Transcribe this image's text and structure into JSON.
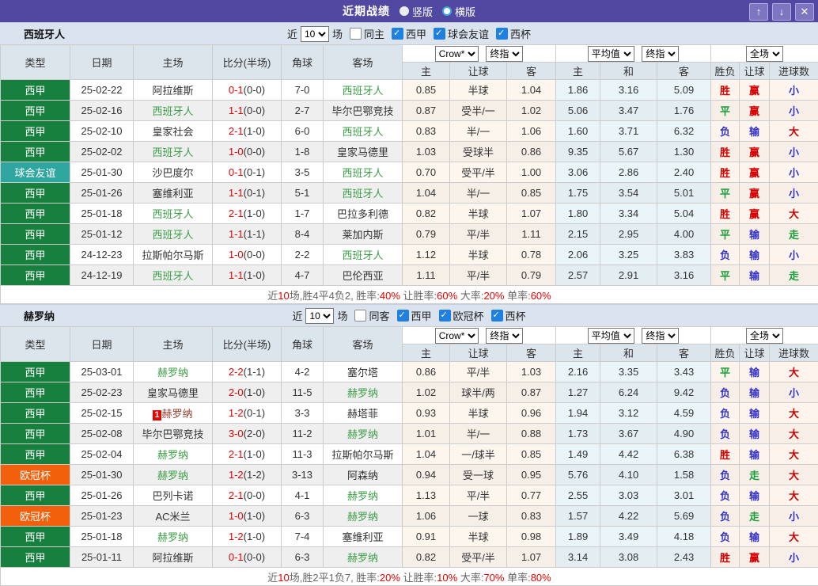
{
  "titlebar": {
    "title": "近期战绩",
    "radios": [
      {
        "label": "竖版",
        "selected": true
      },
      {
        "label": "横版",
        "selected": false
      }
    ],
    "buttons": [
      {
        "name": "move-up",
        "glyph": "↑"
      },
      {
        "name": "move-down",
        "glyph": "↓"
      },
      {
        "name": "close",
        "glyph": "✕"
      }
    ]
  },
  "table_header": {
    "base": [
      "类型",
      "日期",
      "主场",
      "比分(半场)",
      "角球",
      "客场"
    ],
    "sub": [
      "主",
      "让球",
      "客",
      "主",
      "和",
      "客",
      "胜负",
      "让球",
      "进球数"
    ]
  },
  "colors": {
    "titlebar": "#5149A1",
    "laliga_tag": "#18803E",
    "friendly_tag": "#2FA6A0",
    "ucl_tag": "#F2600C",
    "focus_team": "#3DA048",
    "win_red": "#D40000",
    "draw_green": "#1A9E3C",
    "loss_blue": "#3333CC"
  },
  "sections": [
    {
      "team": "西班牙人",
      "filter": {
        "near": "近",
        "count": "10",
        "unit": "场",
        "same": {
          "label": "同主",
          "checked": false
        },
        "leagues": [
          {
            "label": "西甲",
            "checked": true
          },
          {
            "label": "球会友谊",
            "checked": true
          },
          {
            "label": "西杯",
            "checked": true
          }
        ]
      },
      "dropdowns": [
        "Crow*",
        "终指",
        "平均值",
        "终指",
        "全场"
      ],
      "rows": [
        {
          "t": "西甲",
          "tc": "liga",
          "d": "25-02-22",
          "h": "阿拉维斯",
          "hc": "",
          "hb": "",
          "s": "0-1",
          "hf": "(0-0)",
          "c": "7-0",
          "a": "西班牙人",
          "ac": "tg",
          "o1": "0.85",
          "o2": "半球",
          "o3": "1.04",
          "e1": "1.86",
          "e2": "3.16",
          "e3": "5.09",
          "r1": "胜",
          "r2": "赢",
          "r3": "小"
        },
        {
          "t": "西甲",
          "tc": "liga",
          "d": "25-02-16",
          "h": "西班牙人",
          "hc": "tg",
          "hb": "",
          "s": "1-1",
          "hf": "(0-0)",
          "c": "2-7",
          "a": "毕尔巴鄂竞技",
          "ac": "",
          "o1": "0.87",
          "o2": "受半/一",
          "o3": "1.02",
          "e1": "5.06",
          "e2": "3.47",
          "e3": "1.76",
          "r1": "平",
          "r2": "赢",
          "r3": "小"
        },
        {
          "t": "西甲",
          "tc": "liga",
          "d": "25-02-10",
          "h": "皇家社会",
          "hc": "",
          "hb": "",
          "s": "2-1",
          "hf": "(1-0)",
          "c": "6-0",
          "a": "西班牙人",
          "ac": "tg",
          "o1": "0.83",
          "o2": "半/一",
          "o3": "1.06",
          "e1": "1.60",
          "e2": "3.71",
          "e3": "6.32",
          "r1": "负",
          "r2": "输",
          "r3": "大"
        },
        {
          "t": "西甲",
          "tc": "liga",
          "d": "25-02-02",
          "h": "西班牙人",
          "hc": "tg",
          "hb": "",
          "s": "1-0",
          "hf": "(0-0)",
          "c": "1-8",
          "a": "皇家马德里",
          "ac": "",
          "o1": "1.03",
          "o2": "受球半",
          "o3": "0.86",
          "e1": "9.35",
          "e2": "5.67",
          "e3": "1.30",
          "r1": "胜",
          "r2": "赢",
          "r3": "小"
        },
        {
          "t": "球会友谊",
          "tc": "fri",
          "d": "25-01-30",
          "h": "沙巴度尔",
          "hc": "",
          "hb": "",
          "s": "0-1",
          "hf": "(0-1)",
          "c": "3-5",
          "a": "西班牙人",
          "ac": "tg",
          "o1": "0.70",
          "o2": "受平/半",
          "o3": "1.00",
          "e1": "3.06",
          "e2": "2.86",
          "e3": "2.40",
          "r1": "胜",
          "r2": "赢",
          "r3": "小"
        },
        {
          "t": "西甲",
          "tc": "liga",
          "d": "25-01-26",
          "h": "塞维利亚",
          "hc": "",
          "hb": "",
          "s": "1-1",
          "hf": "(0-1)",
          "c": "5-1",
          "a": "西班牙人",
          "ac": "tg",
          "o1": "1.04",
          "o2": "半/一",
          "o3": "0.85",
          "e1": "1.75",
          "e2": "3.54",
          "e3": "5.01",
          "r1": "平",
          "r2": "赢",
          "r3": "小"
        },
        {
          "t": "西甲",
          "tc": "liga",
          "d": "25-01-18",
          "h": "西班牙人",
          "hc": "tg",
          "hb": "",
          "s": "2-1",
          "hf": "(1-0)",
          "c": "1-7",
          "a": "巴拉多利德",
          "ac": "",
          "o1": "0.82",
          "o2": "半球",
          "o3": "1.07",
          "e1": "1.80",
          "e2": "3.34",
          "e3": "5.04",
          "r1": "胜",
          "r2": "赢",
          "r3": "大"
        },
        {
          "t": "西甲",
          "tc": "liga",
          "d": "25-01-12",
          "h": "西班牙人",
          "hc": "tg",
          "hb": "",
          "s": "1-1",
          "hf": "(1-1)",
          "c": "8-4",
          "a": "莱加内斯",
          "ac": "",
          "o1": "0.79",
          "o2": "平/半",
          "o3": "1.11",
          "e1": "2.15",
          "e2": "2.95",
          "e3": "4.00",
          "r1": "平",
          "r2": "输",
          "r3": "走"
        },
        {
          "t": "西甲",
          "tc": "liga",
          "d": "24-12-23",
          "h": "拉斯帕尔马斯",
          "hc": "",
          "hb": "",
          "s": "1-0",
          "hf": "(0-0)",
          "c": "2-2",
          "a": "西班牙人",
          "ac": "tg",
          "o1": "1.12",
          "o2": "半球",
          "o3": "0.78",
          "e1": "2.06",
          "e2": "3.25",
          "e3": "3.83",
          "r1": "负",
          "r2": "输",
          "r3": "小"
        },
        {
          "t": "西甲",
          "tc": "liga",
          "d": "24-12-19",
          "h": "西班牙人",
          "hc": "tg",
          "hb": "",
          "s": "1-1",
          "hf": "(1-0)",
          "c": "4-7",
          "a": "巴伦西亚",
          "ac": "",
          "o1": "1.11",
          "o2": "平/半",
          "o3": "0.79",
          "e1": "2.57",
          "e2": "2.91",
          "e3": "3.16",
          "r1": "平",
          "r2": "输",
          "r3": "走"
        }
      ],
      "summary": [
        [
          "近",
          false
        ],
        [
          "10",
          true
        ],
        [
          "场,胜4平4负2, 胜率:",
          false
        ],
        [
          "40%",
          true
        ],
        [
          " 让胜率:",
          false
        ],
        [
          "60%",
          true
        ],
        [
          " 大率:",
          false
        ],
        [
          "20%",
          true
        ],
        [
          " 单率:",
          false
        ],
        [
          "60%",
          true
        ]
      ]
    },
    {
      "team": "赫罗纳",
      "filter": {
        "near": "近",
        "count": "10",
        "unit": "场",
        "same": {
          "label": "同客",
          "checked": false
        },
        "leagues": [
          {
            "label": "西甲",
            "checked": true
          },
          {
            "label": "欧冠杯",
            "checked": true
          },
          {
            "label": "西杯",
            "checked": true
          }
        ]
      },
      "dropdowns": [
        "Crow*",
        "终指",
        "平均值",
        "终指",
        "全场"
      ],
      "rows": [
        {
          "t": "西甲",
          "tc": "liga",
          "d": "25-03-01",
          "h": "赫罗纳",
          "hc": "tg",
          "hb": "",
          "s": "2-2",
          "hf": "(1-1)",
          "c": "4-2",
          "a": "塞尔塔",
          "ac": "",
          "o1": "0.86",
          "o2": "平/半",
          "o3": "1.03",
          "e1": "2.16",
          "e2": "3.35",
          "e3": "3.43",
          "r1": "平",
          "r2": "输",
          "r3": "大"
        },
        {
          "t": "西甲",
          "tc": "liga",
          "d": "25-02-23",
          "h": "皇家马德里",
          "hc": "",
          "hb": "",
          "s": "2-0",
          "hf": "(1-0)",
          "c": "11-5",
          "a": "赫罗纳",
          "ac": "tg",
          "o1": "1.02",
          "o2": "球半/两",
          "o3": "0.87",
          "e1": "1.27",
          "e2": "6.24",
          "e3": "9.42",
          "r1": "负",
          "r2": "输",
          "r3": "小"
        },
        {
          "t": "西甲",
          "tc": "liga",
          "d": "25-02-15",
          "h": "赫罗纳",
          "hc": "tm",
          "hb": "1",
          "s": "1-2",
          "hf": "(0-1)",
          "c": "3-3",
          "a": "赫塔菲",
          "ac": "",
          "o1": "0.93",
          "o2": "半球",
          "o3": "0.96",
          "e1": "1.94",
          "e2": "3.12",
          "e3": "4.59",
          "r1": "负",
          "r2": "输",
          "r3": "大"
        },
        {
          "t": "西甲",
          "tc": "liga",
          "d": "25-02-08",
          "h": "毕尔巴鄂竞技",
          "hc": "",
          "hb": "",
          "s": "3-0",
          "hf": "(2-0)",
          "c": "11-2",
          "a": "赫罗纳",
          "ac": "tg",
          "o1": "1.01",
          "o2": "半/一",
          "o3": "0.88",
          "e1": "1.73",
          "e2": "3.67",
          "e3": "4.90",
          "r1": "负",
          "r2": "输",
          "r3": "大"
        },
        {
          "t": "西甲",
          "tc": "liga",
          "d": "25-02-04",
          "h": "赫罗纳",
          "hc": "tg",
          "hb": "",
          "s": "2-1",
          "hf": "(1-0)",
          "c": "11-3",
          "a": "拉斯帕尔马斯",
          "ac": "",
          "o1": "1.04",
          "o2": "一/球半",
          "o3": "0.85",
          "e1": "1.49",
          "e2": "4.42",
          "e3": "6.38",
          "r1": "胜",
          "r2": "输",
          "r3": "大"
        },
        {
          "t": "欧冠杯",
          "tc": "ucl",
          "d": "25-01-30",
          "h": "赫罗纳",
          "hc": "tg",
          "hb": "",
          "s": "1-2",
          "hf": "(1-2)",
          "c": "3-13",
          "a": "阿森纳",
          "ac": "",
          "o1": "0.94",
          "o2": "受一球",
          "o3": "0.95",
          "e1": "5.76",
          "e2": "4.10",
          "e3": "1.58",
          "r1": "负",
          "r2": "走",
          "r3": "大"
        },
        {
          "t": "西甲",
          "tc": "liga",
          "d": "25-01-26",
          "h": "巴列卡诺",
          "hc": "",
          "hb": "",
          "s": "2-1",
          "hf": "(0-0)",
          "c": "4-1",
          "a": "赫罗纳",
          "ac": "tg",
          "o1": "1.13",
          "o2": "平/半",
          "o3": "0.77",
          "e1": "2.55",
          "e2": "3.03",
          "e3": "3.01",
          "r1": "负",
          "r2": "输",
          "r3": "大"
        },
        {
          "t": "欧冠杯",
          "tc": "ucl",
          "d": "25-01-23",
          "h": "AC米兰",
          "hc": "",
          "hb": "",
          "s": "1-0",
          "hf": "(1-0)",
          "c": "6-3",
          "a": "赫罗纳",
          "ac": "tg",
          "o1": "1.06",
          "o2": "一球",
          "o3": "0.83",
          "e1": "1.57",
          "e2": "4.22",
          "e3": "5.69",
          "r1": "负",
          "r2": "走",
          "r3": "小"
        },
        {
          "t": "西甲",
          "tc": "liga",
          "d": "25-01-18",
          "h": "赫罗纳",
          "hc": "tg",
          "hb": "",
          "s": "1-2",
          "hf": "(1-0)",
          "c": "7-4",
          "a": "塞维利亚",
          "ac": "",
          "o1": "0.91",
          "o2": "半球",
          "o3": "0.98",
          "e1": "1.89",
          "e2": "3.49",
          "e3": "4.18",
          "r1": "负",
          "r2": "输",
          "r3": "大"
        },
        {
          "t": "西甲",
          "tc": "liga",
          "d": "25-01-11",
          "h": "阿拉维斯",
          "hc": "",
          "hb": "",
          "s": "0-1",
          "hf": "(0-0)",
          "c": "6-3",
          "a": "赫罗纳",
          "ac": "tg",
          "o1": "0.82",
          "o2": "受平/半",
          "o3": "1.07",
          "e1": "3.14",
          "e2": "3.08",
          "e3": "2.43",
          "r1": "胜",
          "r2": "赢",
          "r3": "小"
        }
      ],
      "summary": [
        [
          "近",
          false
        ],
        [
          "10",
          true
        ],
        [
          "场,胜2平1负7, 胜率:",
          false
        ],
        [
          "20%",
          true
        ],
        [
          " 让胜率:",
          false
        ],
        [
          "10%",
          true
        ],
        [
          " 大率:",
          false
        ],
        [
          "70%",
          true
        ],
        [
          " 单率:",
          false
        ],
        [
          "80%",
          true
        ]
      ]
    }
  ]
}
